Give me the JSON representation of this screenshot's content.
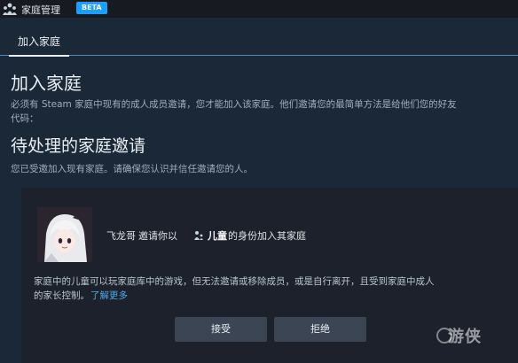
{
  "header": {
    "title": "家庭管理",
    "badge": "BETA",
    "icon": "family-icon"
  },
  "tabs": [
    {
      "label": "加入家庭",
      "active": true
    }
  ],
  "join": {
    "title": "加入家庭",
    "description_line1": "必须有 Steam 家庭中现有的成人成员邀请，您才能加入该家庭。他们邀请您的最简单方法是给他们您的好友",
    "description_line2": "代码："
  },
  "pending": {
    "title": "待处理的家庭邀请",
    "subtitle": "您已受邀加入现有家庭。请确保您认识并信任邀请您的人。",
    "invite": {
      "inviter": "飞龙哥",
      "invite_text": "邀请你以",
      "role_icon": "child-icon",
      "role": "儿童",
      "role_tail": "的身份加入其家庭",
      "body_line1": "家庭中的儿童可以玩家庭库中的游戏，但无法邀请或移除成员，或是自行离开，且受到家庭中成人",
      "body_line2": "的家长控制。",
      "learn_more": "了解更多",
      "accept_label": "接受",
      "decline_label": "拒绝"
    }
  },
  "watermark": "游侠",
  "colors": {
    "background": "#1b2838",
    "topbar": "#171a21",
    "card": "#1c212b",
    "badge": "#1a9fff",
    "link": "#4ea8e8",
    "button": "#3b4553"
  }
}
